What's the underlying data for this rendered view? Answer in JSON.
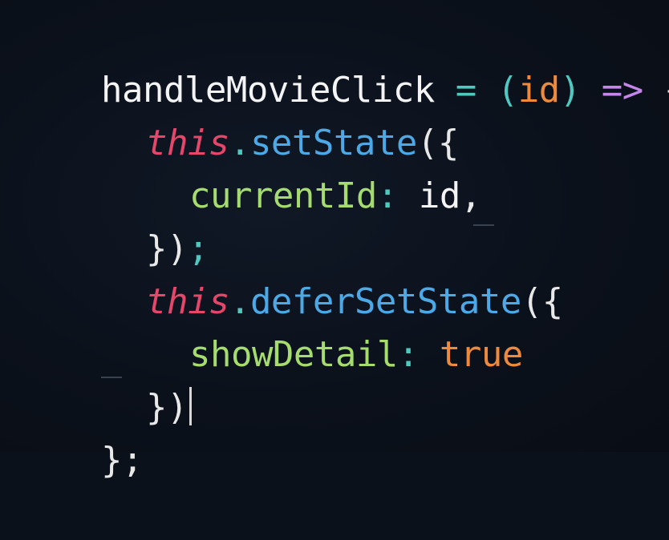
{
  "code": {
    "lines": [
      {
        "tokens": [
          {
            "text": "handleMovieClick",
            "kind": "fn"
          },
          {
            "text": " = ",
            "kind": "op"
          },
          {
            "text": "(",
            "kind": "op"
          },
          {
            "text": "id",
            "kind": "param"
          },
          {
            "text": ")",
            "kind": "op"
          },
          {
            "text": " => ",
            "kind": "arrow"
          },
          {
            "text": "{",
            "kind": "punct"
          }
        ]
      },
      {
        "tokens": [
          {
            "text": "this",
            "kind": "this"
          },
          {
            "text": ".",
            "kind": "op"
          },
          {
            "text": "setState",
            "kind": "method"
          },
          {
            "text": "({",
            "kind": "punct"
          }
        ]
      },
      {
        "tokens": [
          {
            "text": "currentId",
            "kind": "prop"
          },
          {
            "text": ": ",
            "kind": "op"
          },
          {
            "text": "id",
            "kind": "fn"
          },
          {
            "text": ",",
            "kind": "punct"
          }
        ]
      },
      {
        "tokens": [
          {
            "text": "})",
            "kind": "punct"
          },
          {
            "text": ";",
            "kind": "semi"
          }
        ]
      },
      {
        "tokens": [
          {
            "text": "this",
            "kind": "this"
          },
          {
            "text": ".",
            "kind": "op"
          },
          {
            "text": "deferSetState",
            "kind": "method"
          },
          {
            "text": "({",
            "kind": "punct"
          }
        ]
      },
      {
        "tokens": [
          {
            "text": "showDetail",
            "kind": "prop"
          },
          {
            "text": ": ",
            "kind": "op"
          },
          {
            "text": "true",
            "kind": "bool"
          }
        ]
      },
      {
        "tokens": [
          {
            "text": "})",
            "kind": "punct"
          }
        ]
      },
      {
        "tokens": [
          {
            "text": "}",
            "kind": "punct"
          },
          {
            "text": ";",
            "kind": "punct"
          }
        ]
      }
    ]
  },
  "colors": {
    "background": "#0b111b",
    "keyword_this": "#e6466a",
    "method": "#4aa9e6",
    "property": "#a6dc6e",
    "literal": "#ef8a3c",
    "operator": "#4fc8c0",
    "arrow": "#c486e8",
    "text": "#f2f2f2"
  }
}
